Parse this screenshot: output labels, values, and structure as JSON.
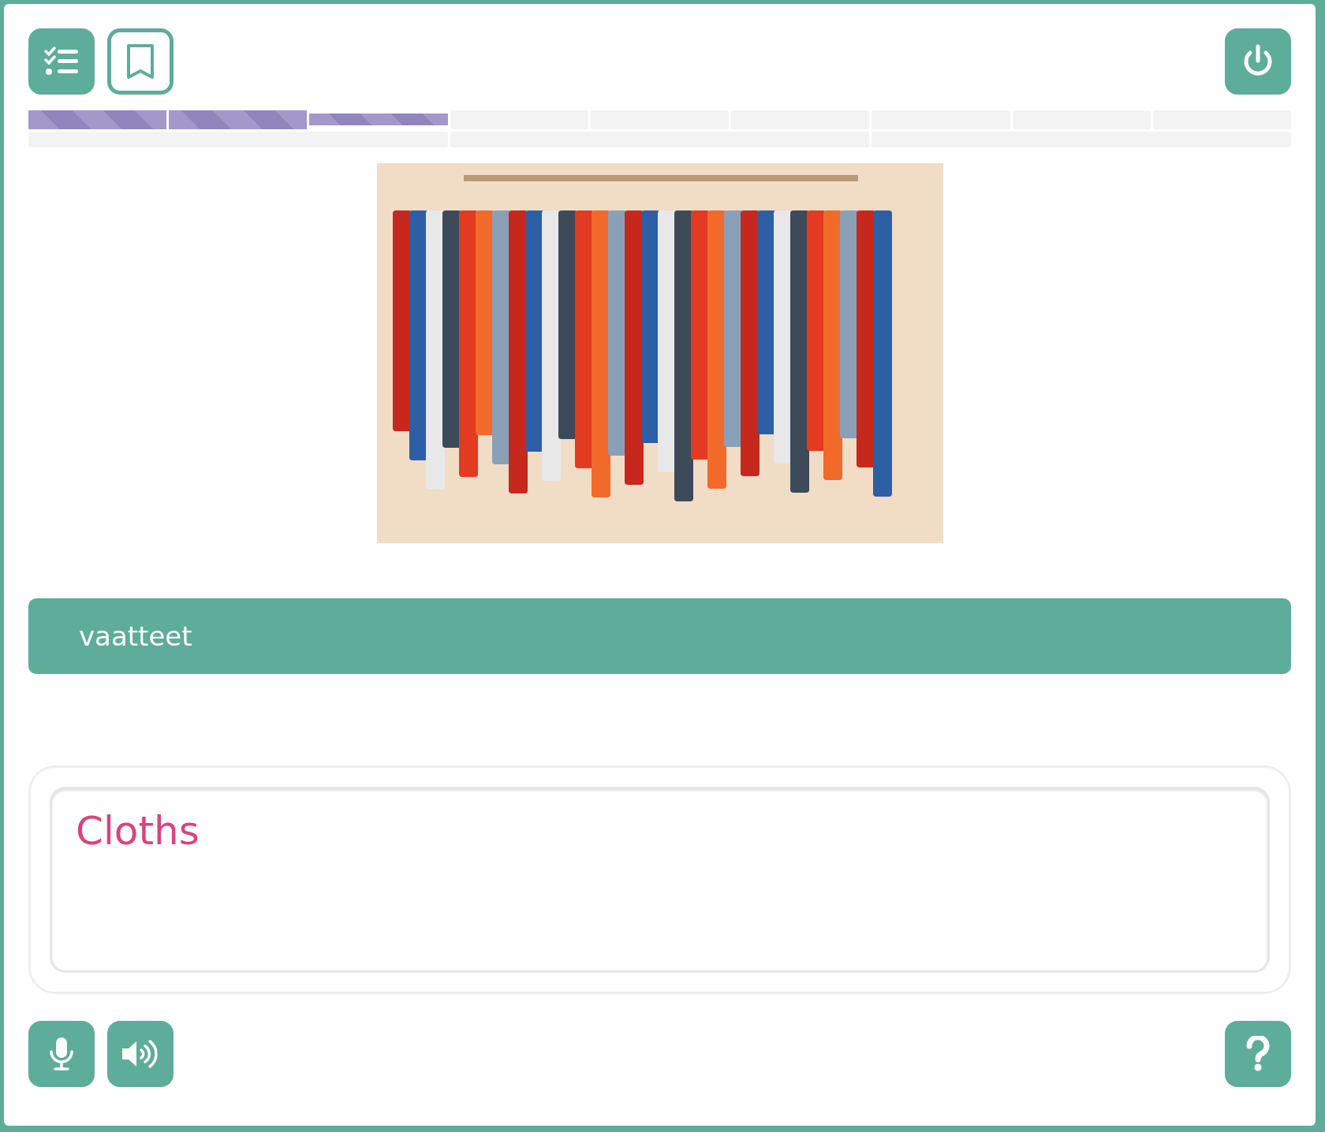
{
  "progress": {
    "rows": [
      [
        {
          "done": true,
          "selected": false
        },
        {
          "done": true,
          "selected": false
        },
        {
          "done": true,
          "selected": true
        },
        {
          "done": false,
          "selected": false
        },
        {
          "done": false,
          "selected": false
        },
        {
          "done": false,
          "selected": false
        },
        {
          "done": false,
          "selected": false
        },
        {
          "done": false,
          "selected": false
        },
        {
          "done": false,
          "selected": false
        }
      ],
      [
        {
          "done": false,
          "selected": false
        },
        {
          "done": false,
          "selected": false
        },
        {
          "done": false,
          "selected": false
        }
      ]
    ]
  },
  "prompt": {
    "word": "vaatteet"
  },
  "answer": {
    "value": "Cloths"
  }
}
